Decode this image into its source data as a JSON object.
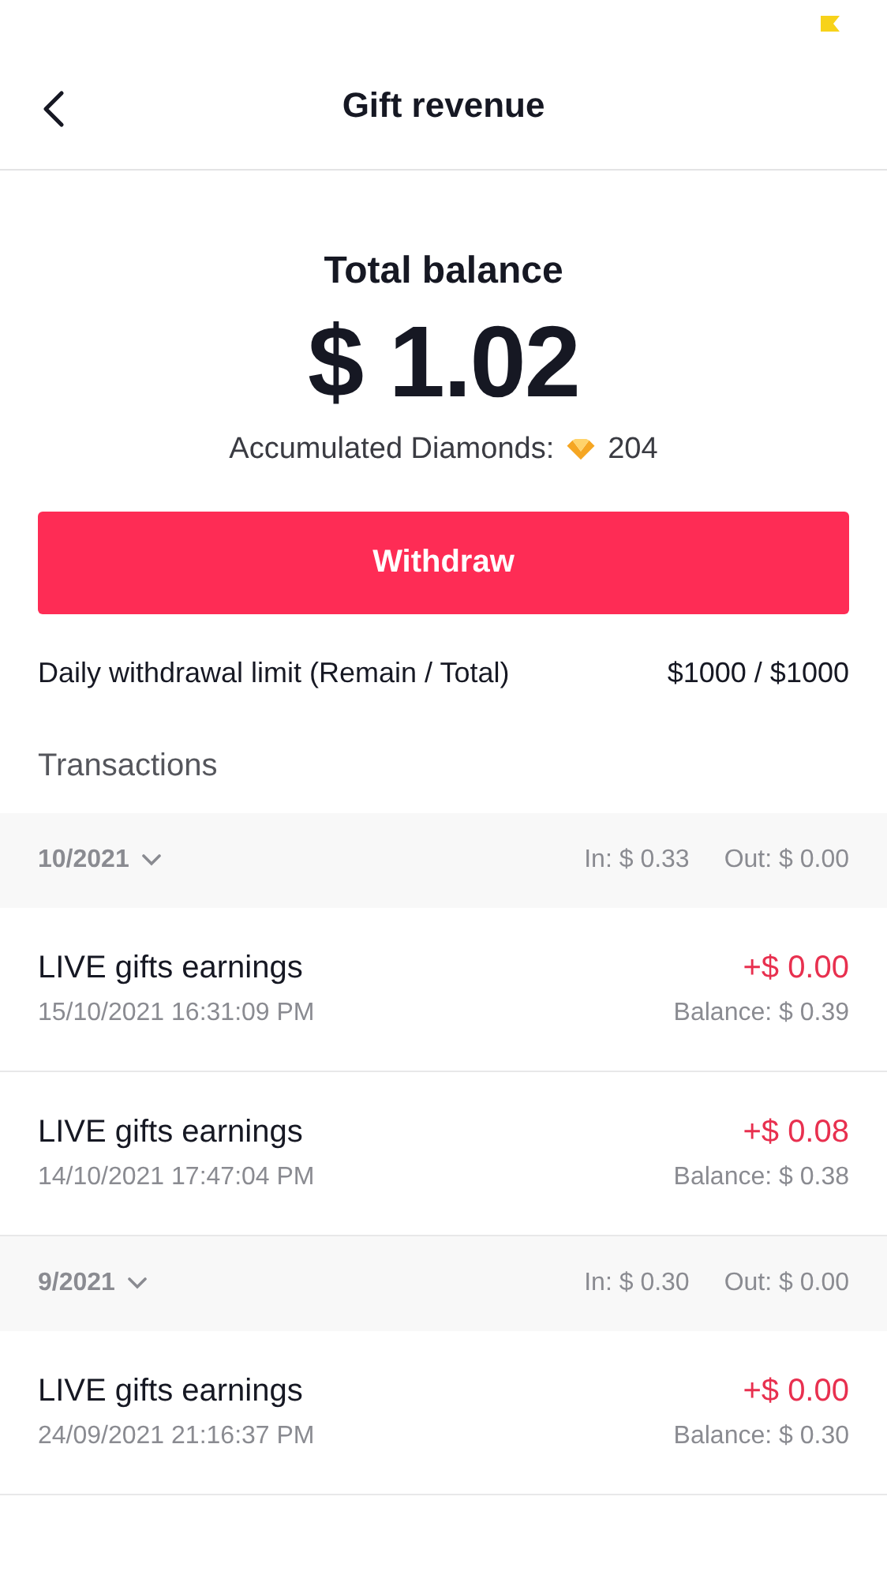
{
  "header": {
    "title": "Gift revenue"
  },
  "balance": {
    "label": "Total balance",
    "amount": "$ 1.02",
    "diamonds_label": "Accumulated Diamonds:",
    "diamonds": "204"
  },
  "withdraw_button": "Withdraw",
  "limit": {
    "label": "Daily withdrawal limit (Remain / Total)",
    "value": "$1000 / $1000"
  },
  "transactions_title": "Transactions",
  "groups": [
    {
      "month": "10/2021",
      "in": "In: $ 0.33",
      "out": "Out: $ 0.00",
      "items": [
        {
          "title": "LIVE gifts earnings",
          "date": "15/10/2021 16:31:09 PM",
          "amount": "+$ 0.00",
          "balance": "Balance: $ 0.39"
        },
        {
          "title": "LIVE gifts earnings",
          "date": "14/10/2021 17:47:04 PM",
          "amount": "+$ 0.08",
          "balance": "Balance: $ 0.38"
        }
      ]
    },
    {
      "month": "9/2021",
      "in": "In: $ 0.30",
      "out": "Out: $ 0.00",
      "items": [
        {
          "title": "LIVE gifts earnings",
          "date": "24/09/2021 21:16:37 PM",
          "amount": "+$ 0.00",
          "balance": "Balance: $ 0.30"
        }
      ]
    }
  ]
}
